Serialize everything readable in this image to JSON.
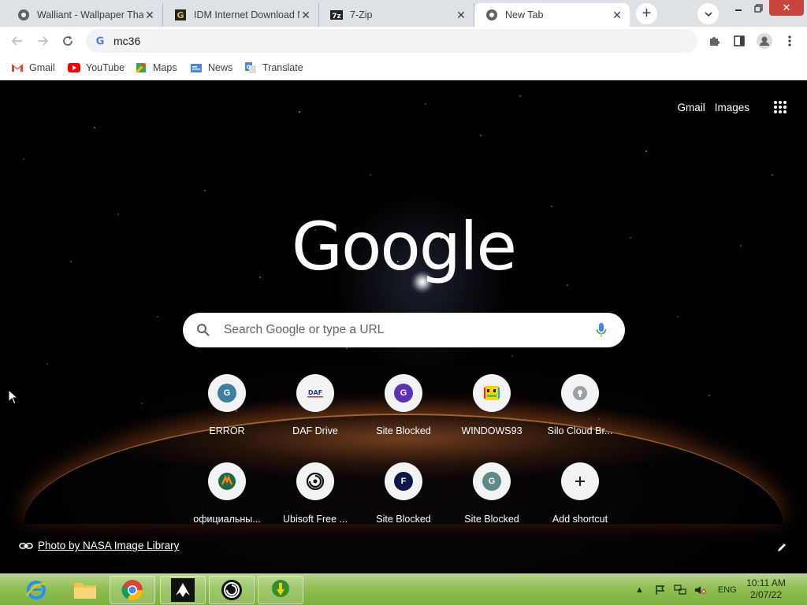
{
  "tabs": [
    {
      "title": "Walliant - Wallpaper That",
      "favicon": "walliant-icon",
      "active": false
    },
    {
      "title": "IDM Internet Download M",
      "favicon": "idm-icon",
      "active": false
    },
    {
      "title": "7-Zip",
      "favicon": "7zip-icon",
      "active": false
    },
    {
      "title": "New Tab",
      "favicon": "chrome-icon",
      "active": true
    }
  ],
  "omnibox": {
    "value": "mc36"
  },
  "bookmarks": [
    {
      "label": "Gmail",
      "icon": "gmail-icon"
    },
    {
      "label": "YouTube",
      "icon": "youtube-icon"
    },
    {
      "label": "Maps",
      "icon": "maps-icon"
    },
    {
      "label": "News",
      "icon": "news-icon"
    },
    {
      "label": "Translate",
      "icon": "translate-icon"
    }
  ],
  "ntp": {
    "gmail": "Gmail",
    "images": "Images",
    "logo": "Google",
    "search_placeholder": "Search Google or type a URL",
    "photo_credit": "Photo by NASA Image Library"
  },
  "shortcuts": [
    {
      "label": "ERROR",
      "icon": "G",
      "color": "#3d7f9e"
    },
    {
      "label": "DAF Drive",
      "icon": "DAF",
      "color": "#ffffff"
    },
    {
      "label": "Site Blocked",
      "icon": "G",
      "color": "#5b32b4"
    },
    {
      "label": "WINDOWS93",
      "icon": "w93",
      "color": "#ffffff"
    },
    {
      "label": "Silo Cloud Br...",
      "icon": "silo",
      "color": "#9aa0a6"
    },
    {
      "label": "официальны...",
      "icon": "alibaba",
      "color": "#1d6b45"
    },
    {
      "label": "Ubisoft Free ...",
      "icon": "ubisoft",
      "color": "#ffffff"
    },
    {
      "label": "Site Blocked",
      "icon": "F",
      "color": "#0b1a4a"
    },
    {
      "label": "Site Blocked",
      "icon": "G",
      "color": "#5f8a86"
    },
    {
      "label": "Add shortcut",
      "icon": "+",
      "color": "#f1f3f4"
    }
  ],
  "taskbar": {
    "apps": [
      "ie-icon",
      "explorer-icon",
      "chrome-icon",
      "inkscape-icon",
      "ubisoft-icon",
      "idm-icon"
    ],
    "language": "ENG",
    "time": "10:11 AM",
    "date": "2/07/22"
  },
  "colors": {
    "tabstrip": "#dee1e6",
    "taskbar": "#8fbf52",
    "close": "#c9453c"
  }
}
